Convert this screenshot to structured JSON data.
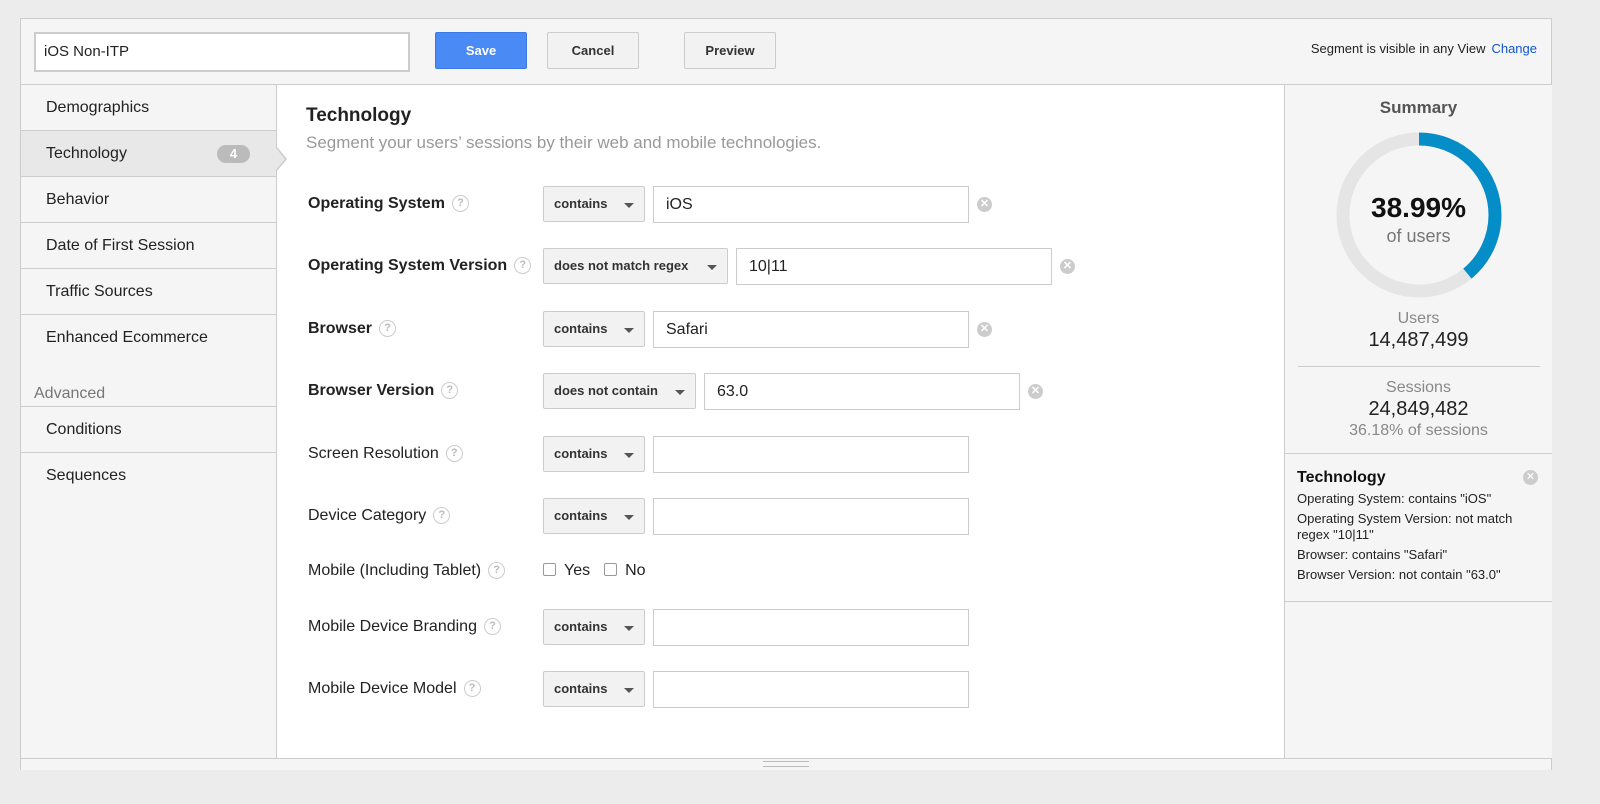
{
  "header": {
    "segment_name": "iOS Non-ITP",
    "save": "Save",
    "cancel": "Cancel",
    "preview": "Preview",
    "visibility": "Segment is visible in any View",
    "change": "Change"
  },
  "sidebar": {
    "items": [
      {
        "label": "Demographics"
      },
      {
        "label": "Technology",
        "badge": "4"
      },
      {
        "label": "Behavior"
      },
      {
        "label": "Date of First Session"
      },
      {
        "label": "Traffic Sources"
      },
      {
        "label": "Enhanced Ecommerce"
      }
    ],
    "advanced_label": "Advanced",
    "advanced_items": [
      {
        "label": "Conditions"
      },
      {
        "label": "Sequences"
      }
    ]
  },
  "main": {
    "title": "Technology",
    "subtitle": "Segment your users’ sessions by their web and mobile technologies.",
    "help_glyph": "?",
    "rows": [
      {
        "label": "Operating System",
        "bold": true,
        "operator": "contains",
        "value": "iOS"
      },
      {
        "label": "Operating System Version",
        "bold": true,
        "operator": "does not match regex",
        "value": "10|11"
      },
      {
        "label": "Browser",
        "bold": true,
        "operator": "contains",
        "value": "Safari"
      },
      {
        "label": "Browser Version",
        "bold": true,
        "operator": "does not contain",
        "value": "63.0"
      },
      {
        "label": "Screen Resolution",
        "bold": false,
        "operator": "contains",
        "value": ""
      },
      {
        "label": "Device Category",
        "bold": false,
        "operator": "contains",
        "value": ""
      },
      {
        "label": "Mobile (Including Tablet)",
        "bold": false,
        "checkboxes": [
          {
            "label": "Yes",
            "checked": false
          },
          {
            "label": "No",
            "checked": false
          }
        ]
      },
      {
        "label": "Mobile Device Branding",
        "bold": false,
        "operator": "contains",
        "value": ""
      },
      {
        "label": "Mobile Device Model",
        "bold": false,
        "operator": "contains",
        "value": ""
      }
    ]
  },
  "summary": {
    "title": "Summary",
    "percent_users": "38.99%",
    "percent_value": 38.99,
    "of_users": "of users",
    "users_label": "Users",
    "users": "14,487,499",
    "sessions_label": "Sessions",
    "sessions": "24,849,482",
    "sessions_pct": "36.18% of sessions",
    "accent": "#058dc7",
    "track": "#e5e5e5",
    "tech_title": "Technology",
    "tech_lines": [
      "Operating System: contains \"iOS\"",
      "Operating System Version: not match regex \"10|11\"",
      "Browser: contains \"Safari\"",
      "Browser Version: not contain \"63.0\""
    ]
  }
}
